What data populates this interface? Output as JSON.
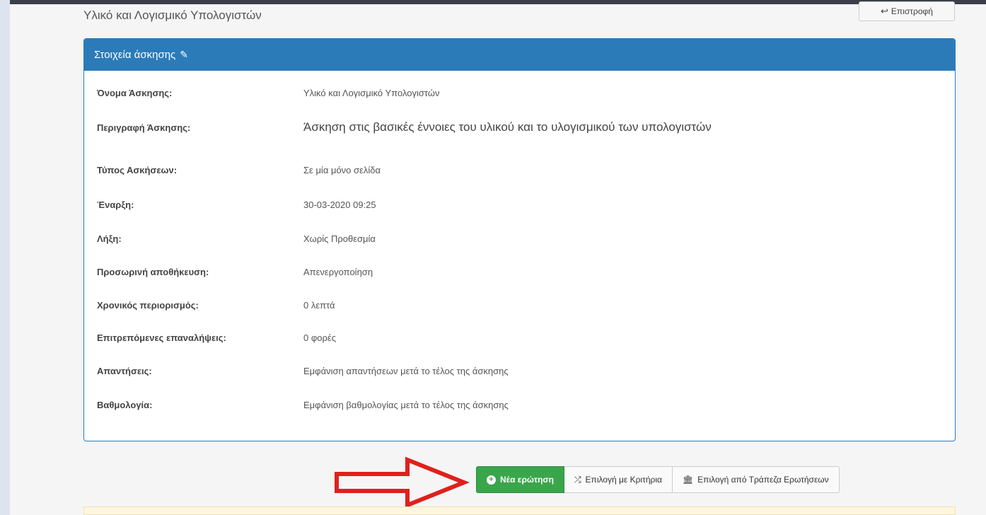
{
  "page": {
    "title": "Υλικό και Λογισμικό Υπολογιστών",
    "back_label": "Επιστροφή"
  },
  "panel": {
    "heading": "Στοιχεία άσκησης",
    "rows": [
      {
        "label": "Όνομα Άσκησης:",
        "value": "Υλικό και Λογισμικό Υπολογιστών"
      },
      {
        "label": "Περιγραφή Άσκησης:",
        "value": "Άσκηση στις βασικές έννοιες του υλικού και το υλογισμικού των υπολογιστών"
      },
      {
        "label": "Τύπος Ασκήσεων:",
        "value": "Σε μία μόνο σελίδα"
      },
      {
        "label": "Έναρξη:",
        "value": "30-03-2020 09:25"
      },
      {
        "label": "Λήξη:",
        "value": "Χωρίς Προθεσμία"
      },
      {
        "label": "Προσωρινή αποθήκευση:",
        "value": "Απενεργοποίηση"
      },
      {
        "label": "Χρονικός περιορισμός:",
        "value": "0 λεπτά"
      },
      {
        "label": "Επιτρεπόμενες επαναλήψεις:",
        "value": "0 φορές"
      },
      {
        "label": "Απαντήσεις:",
        "value": "Εμφάνιση απαντήσεων μετά το τέλος της άσκησης"
      },
      {
        "label": "Βαθμολογία:",
        "value": "Εμφάνιση βαθμολογίας μετά το τέλος της άσκησης"
      }
    ]
  },
  "actions": {
    "new_question": "Νέα ερώτηση",
    "select_criteria": "Επιλογή με Κριτήρια",
    "select_bank": "Επιλογή από Τράπεζα Ερωτήσεων"
  },
  "colors": {
    "panel_header": "#2b7bb9",
    "primary_button": "#3aa54a",
    "arrow": "#e0201c"
  },
  "icons": {
    "back": "reply-icon",
    "edit": "edit-icon",
    "new_question": "plus-circle-icon",
    "criteria": "shuffle-icon",
    "bank": "bank-icon"
  }
}
